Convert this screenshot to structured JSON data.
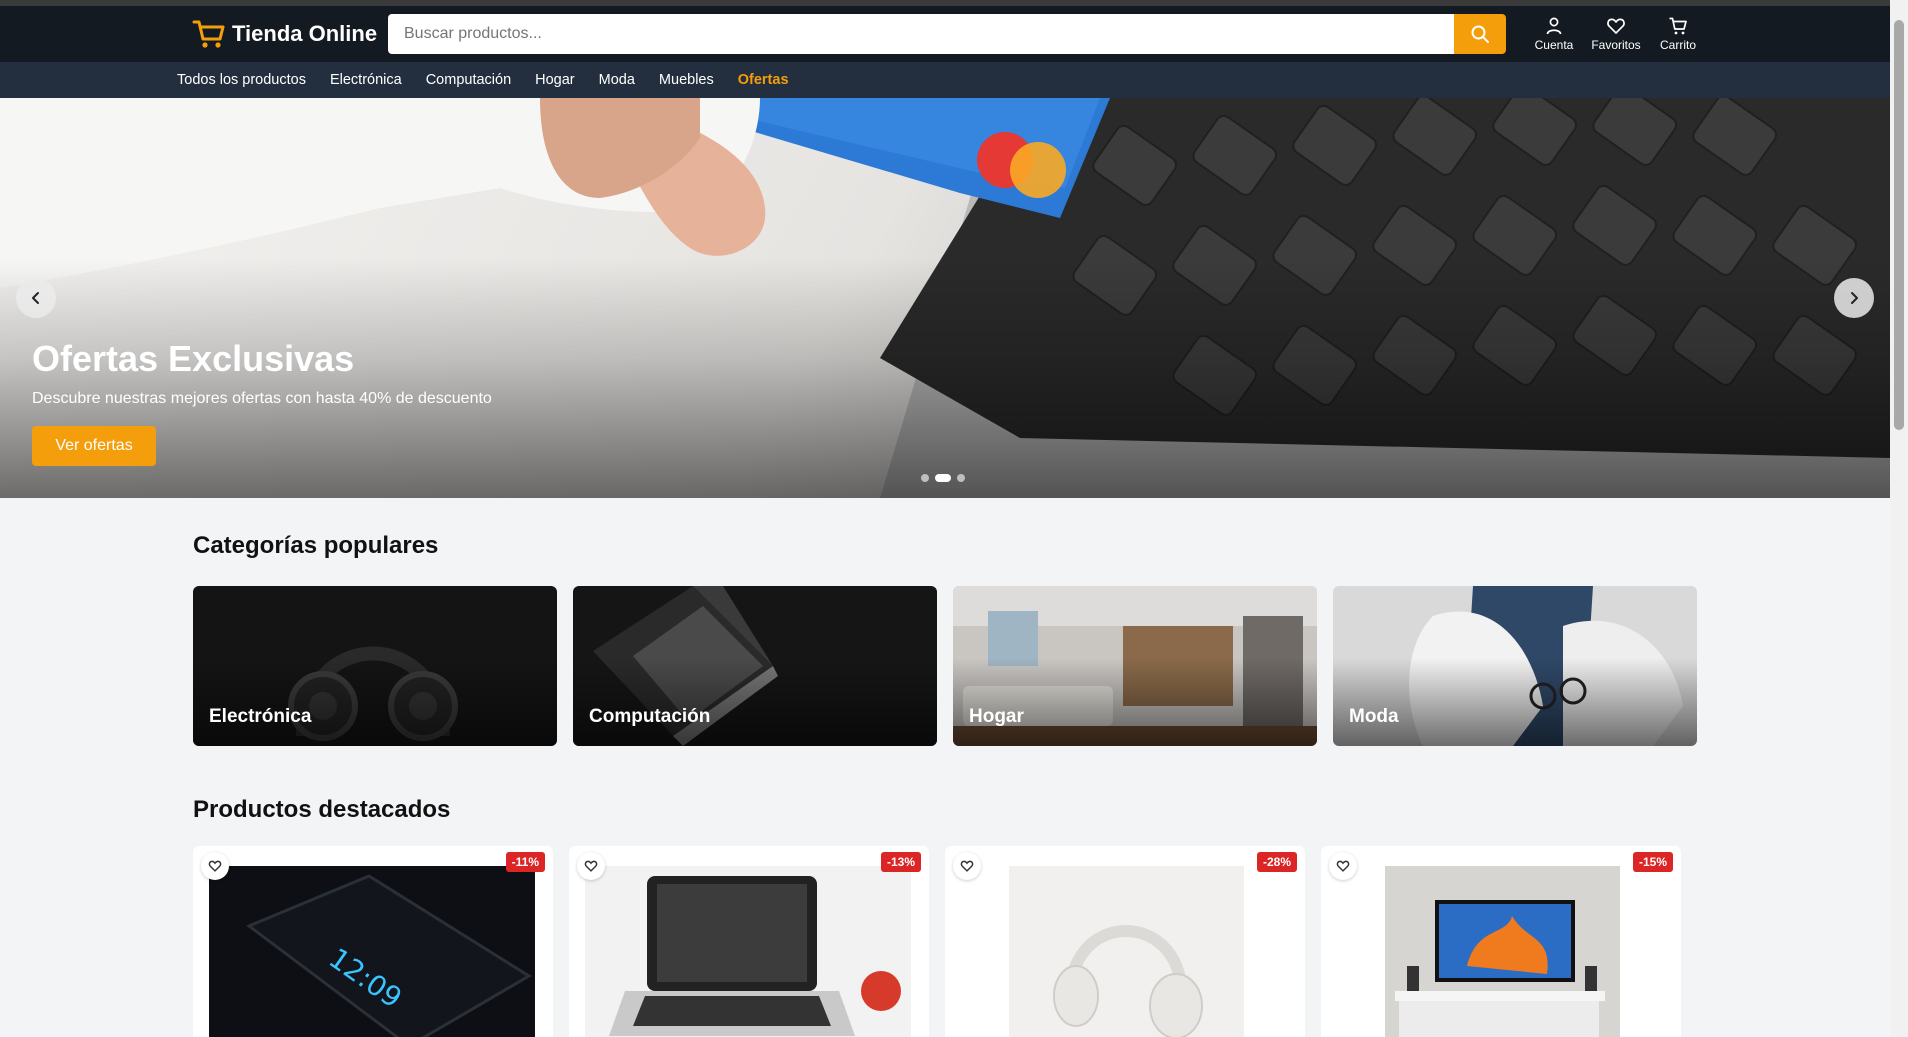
{
  "brand": {
    "name": "Tienda Online"
  },
  "search": {
    "placeholder": "Buscar productos..."
  },
  "header_actions": [
    {
      "label": "Cuenta",
      "icon": "user-icon"
    },
    {
      "label": "Favoritos",
      "icon": "heart-icon"
    },
    {
      "label": "Carrito",
      "icon": "cart-icon"
    }
  ],
  "nav": {
    "items": [
      "Todos los productos",
      "Electrónica",
      "Computación",
      "Hogar",
      "Moda",
      "Muebles",
      "Ofertas"
    ],
    "active": "Ofertas"
  },
  "hero": {
    "title": "Ofertas Exclusivas",
    "subtitle": "Descubre nuestras mejores ofertas con hasta 40% de descuento",
    "cta": "Ver ofertas",
    "slides": 3,
    "active_slide": 2
  },
  "categories": {
    "title": "Categorías populares",
    "items": [
      "Electrónica",
      "Computación",
      "Hogar",
      "Moda"
    ]
  },
  "featured": {
    "title": "Productos destacados",
    "items": [
      {
        "discount": "-11%"
      },
      {
        "discount": "-13%"
      },
      {
        "discount": "-28%"
      },
      {
        "discount": "-15%"
      }
    ]
  },
  "colors": {
    "accent": "#f59e0b",
    "header": "#131a22",
    "nav": "#232f3e",
    "badge": "#dc2626"
  }
}
